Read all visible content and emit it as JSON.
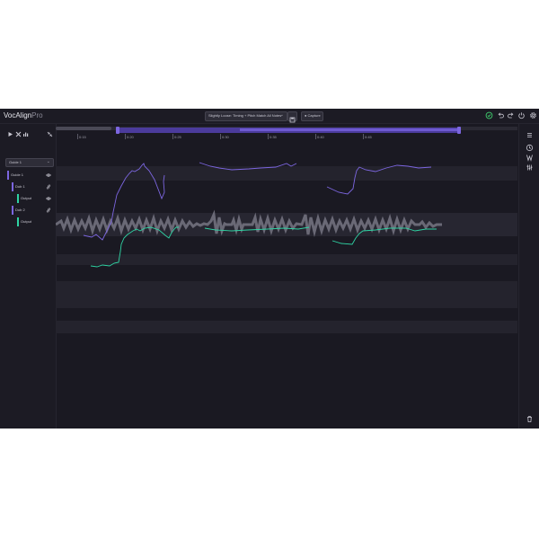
{
  "app": {
    "name": "VocAlign",
    "edition": "Pro"
  },
  "toolbar": {
    "preset": "Slightly Loose: Timing + Pitch Match All Notes",
    "capture_label": "Capture"
  },
  "left_panel": {
    "guide_select": "Guide 1",
    "tracks": [
      {
        "label": "Guide 1",
        "color": "#7c66e0",
        "icon": "eye-icon"
      },
      {
        "label": "Dub 1",
        "color": "#7c66e0",
        "icon": "link-icon"
      },
      {
        "label": "Output",
        "color": "#2fd3a3",
        "icon": "eye-icon"
      },
      {
        "label": "Dub 2",
        "color": "#7c66e0",
        "icon": "link-icon"
      },
      {
        "label": "Output",
        "color": "#2fd3a3",
        "icon": "eye-icon"
      }
    ]
  },
  "ruler": {
    "ticks": [
      "0:15",
      "0:20",
      "0:25",
      "0:30",
      "0:35",
      "0:40",
      "0:45"
    ]
  },
  "colors": {
    "guide_curve": "#7c66e0",
    "output_curve": "#2fd3a3",
    "accent": "#6e5ad0",
    "status_ok": "#3fcf6e"
  }
}
